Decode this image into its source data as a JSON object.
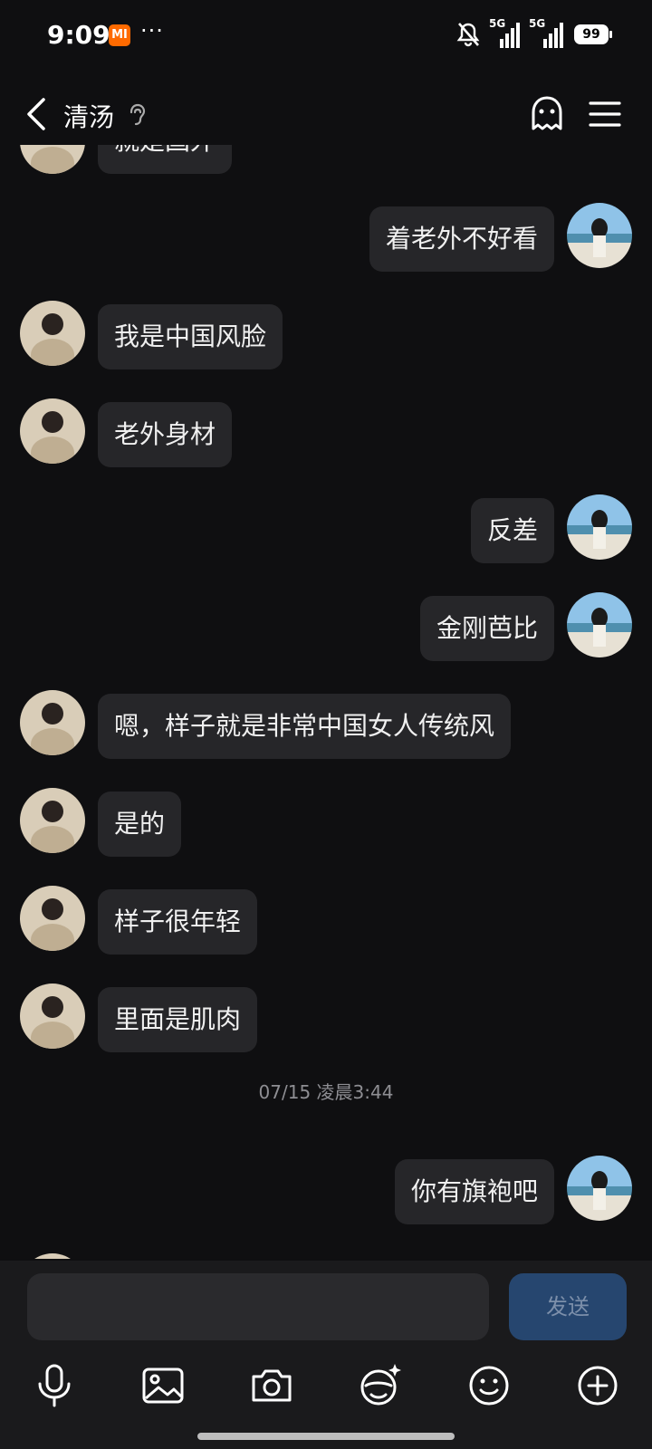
{
  "status_bar": {
    "time": "9:09",
    "mi_label": "MI",
    "more_dots": "···",
    "network_1": "5G",
    "network_2": "5G",
    "battery": "99"
  },
  "header": {
    "title": "清汤",
    "back_icon": "chevron-left-icon",
    "ear_icon": "ear-icon",
    "ghost_icon": "ghost-icon",
    "menu_icon": "menu-icon"
  },
  "messages": [
    {
      "side": "left",
      "text": "就是国外"
    },
    {
      "side": "right",
      "text": "着老外不好看"
    },
    {
      "side": "left",
      "text": "我是中国风脸"
    },
    {
      "side": "left",
      "text": "老外身材"
    },
    {
      "side": "right",
      "text": "反差"
    },
    {
      "side": "right",
      "text": "金刚芭比"
    },
    {
      "side": "left",
      "text": "嗯，样子就是非常中国女人传统风"
    },
    {
      "side": "left",
      "text": "是的"
    },
    {
      "side": "left",
      "text": "样子很年轻"
    },
    {
      "side": "left",
      "text": "里面是肌肉"
    },
    {
      "side": "right",
      "text": "你有旗袍吧"
    }
  ],
  "timestamp": "07/15 凌晨3:44",
  "composer": {
    "input_value": "",
    "send_label": "发送"
  },
  "toolbar": [
    "microphone-icon",
    "image-icon",
    "camera-icon",
    "sticker-icon",
    "emoji-icon",
    "plus-icon"
  ],
  "colors": {
    "background": "#0f0f11",
    "bubble": "#262629",
    "send_button": "#26466f",
    "mi_badge": "#ff6a00"
  }
}
